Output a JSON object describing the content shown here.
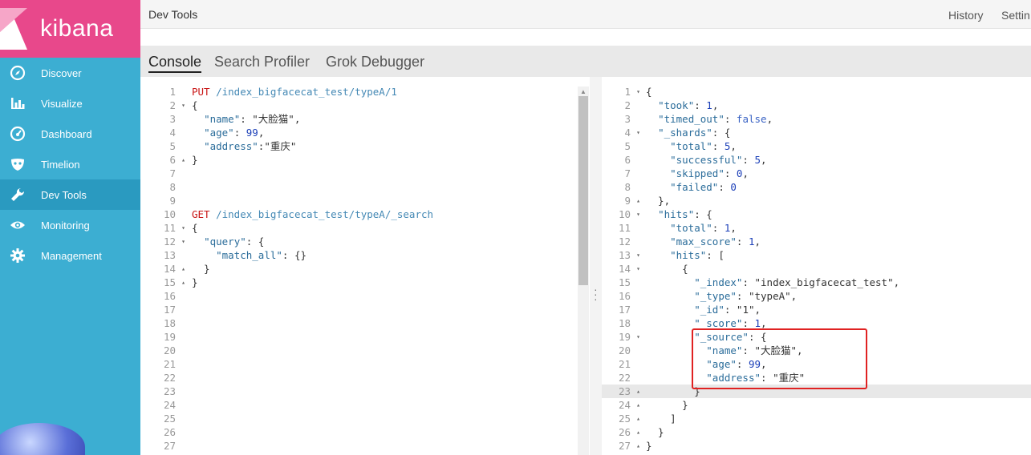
{
  "app": {
    "logo_text": "kibana",
    "page_title": "Dev Tools"
  },
  "colors": {
    "sidebar": "#3caed2",
    "logo_bg": "#e8488b",
    "active_nav": "#2a9ac0",
    "highlight_box": "#e02222"
  },
  "sidebar": {
    "items": [
      {
        "label": "Discover",
        "icon": "compass-icon"
      },
      {
        "label": "Visualize",
        "icon": "bar-chart-icon"
      },
      {
        "label": "Dashboard",
        "icon": "gauge-icon"
      },
      {
        "label": "Timelion",
        "icon": "mask-icon"
      },
      {
        "label": "Dev Tools",
        "icon": "wrench-icon",
        "active": true
      },
      {
        "label": "Monitoring",
        "icon": "eye-icon"
      },
      {
        "label": "Management",
        "icon": "gear-icon"
      }
    ]
  },
  "topbar": {
    "history": "History",
    "settings": "Settin"
  },
  "tabs": [
    {
      "label": "Console",
      "active": true
    },
    {
      "label": "Search Profiler"
    },
    {
      "label": "Grok Debugger"
    }
  ],
  "request_editor": {
    "line_numbers": [
      "1",
      "2",
      "3",
      "4",
      "5",
      "6",
      "7",
      "8",
      "9",
      "10",
      "11",
      "12",
      "13",
      "14",
      "15",
      "16",
      "17",
      "18",
      "19",
      "20",
      "21",
      "22",
      "23",
      "24",
      "25",
      "26",
      "27"
    ],
    "lines": [
      "PUT /index_bigfacecat_test/typeA/1",
      "{",
      "  \"name\": \"大脸猫\",",
      "  \"age\": 99,",
      "  \"address\":\"重庆\"",
      "}",
      "",
      "",
      "",
      "GET /index_bigfacecat_test/typeA/_search",
      "{",
      "  \"query\": {",
      "    \"match_all\": {}",
      "  }",
      "}",
      "",
      "",
      "",
      "",
      "",
      "",
      "",
      "",
      "",
      "",
      "",
      ""
    ]
  },
  "response_editor": {
    "line_numbers": [
      "1",
      "2",
      "3",
      "4",
      "5",
      "6",
      "7",
      "8",
      "9",
      "10",
      "11",
      "12",
      "13",
      "14",
      "15",
      "16",
      "17",
      "18",
      "19",
      "20",
      "21",
      "22",
      "23",
      "24",
      "25",
      "26",
      "27"
    ],
    "lines": [
      "{",
      "  \"took\": 1,",
      "  \"timed_out\": false,",
      "  \"_shards\": {",
      "    \"total\": 5,",
      "    \"successful\": 5,",
      "    \"skipped\": 0,",
      "    \"failed\": 0",
      "  },",
      "  \"hits\": {",
      "    \"total\": 1,",
      "    \"max_score\": 1,",
      "    \"hits\": [",
      "      {",
      "        \"_index\": \"index_bigfacecat_test\",",
      "        \"_type\": \"typeA\",",
      "        \"_id\": \"1\",",
      "        \"_score\": 1,",
      "        \"_source\": {",
      "          \"name\": \"大脸猫\",",
      "          \"age\": 99,",
      "          \"address\": \"重庆\"",
      "        }",
      "      }",
      "    ]",
      "  }",
      "}"
    ]
  }
}
